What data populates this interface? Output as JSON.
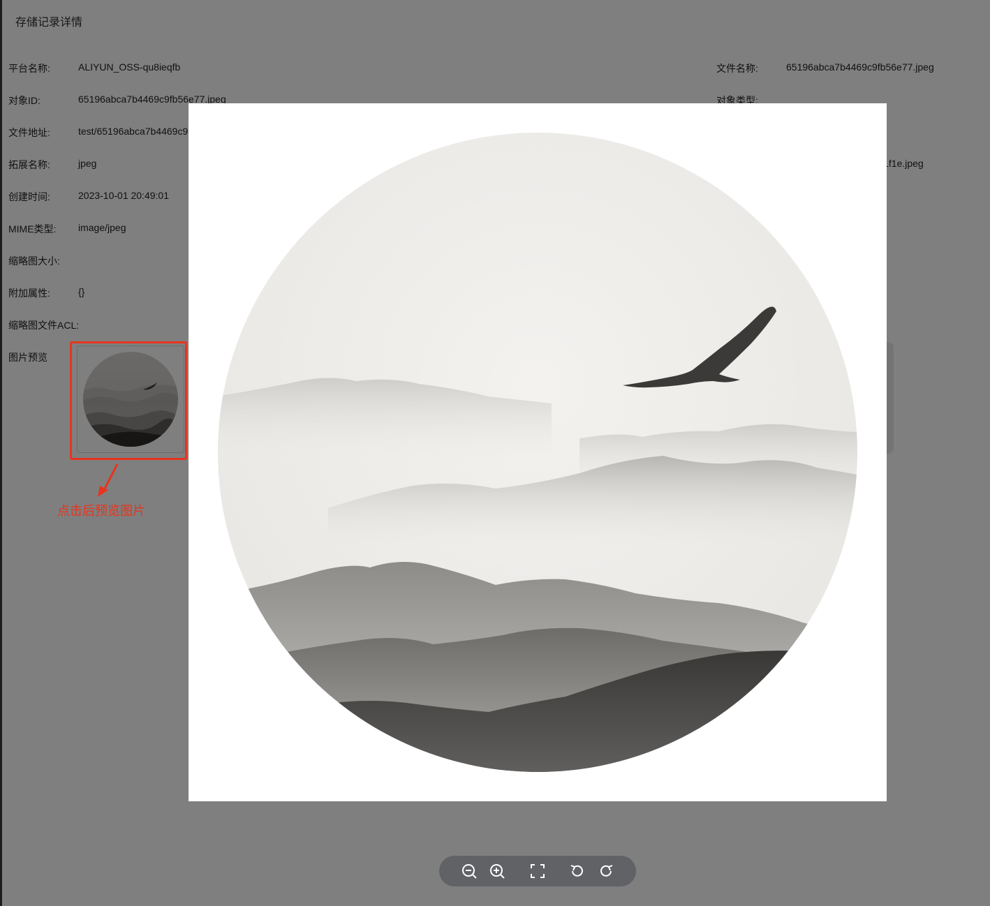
{
  "dialog": {
    "title": "存储记录详情"
  },
  "fields": {
    "platform": {
      "label": "平台名称:",
      "value": "ALIYUN_OSS-qu8ieqfb"
    },
    "file_name": {
      "label": "文件名称:",
      "value": "65196abca7b4469c9fb56e77.jpeg"
    },
    "object_id": {
      "label": "对象ID:",
      "value": "65196abca7b4469c9fb56e77.jpeg"
    },
    "object_type": {
      "label": "对象类型:",
      "value": ""
    },
    "file_url": {
      "label": "文件地址:",
      "value": "test/65196abca7b4469c9"
    },
    "extension": {
      "label": "拓展名称:",
      "value": "jpeg"
    },
    "right_partial": {
      "value": "l1f1e.jpeg"
    },
    "created_at": {
      "label": "创建时间:",
      "value": "2023-10-01 20:49:01"
    },
    "mime": {
      "label": "MIME类型:",
      "value": "image/jpeg"
    },
    "thumb_size": {
      "label": "缩略图大小:",
      "value": ""
    },
    "extra_attrs": {
      "label": "附加属性:",
      "value": "{}"
    },
    "thumb_acl": {
      "label": "缩略图文件ACL:",
      "value": ""
    },
    "image_preview": {
      "label": "图片预览"
    }
  },
  "annotation": {
    "text": "点击后预览图片",
    "color": "#e8341c"
  },
  "viewer": {
    "toolbar": [
      {
        "name": "zoom-out-icon"
      },
      {
        "name": "zoom-in-icon"
      },
      {
        "name": "fullscreen-icon"
      },
      {
        "name": "rotate-left-icon"
      },
      {
        "name": "rotate-right-icon"
      }
    ]
  },
  "colors": {
    "mask": "rgba(0,0,0,0.5)",
    "toolbar_bg": "#606266",
    "annotation": "#e8341c"
  }
}
